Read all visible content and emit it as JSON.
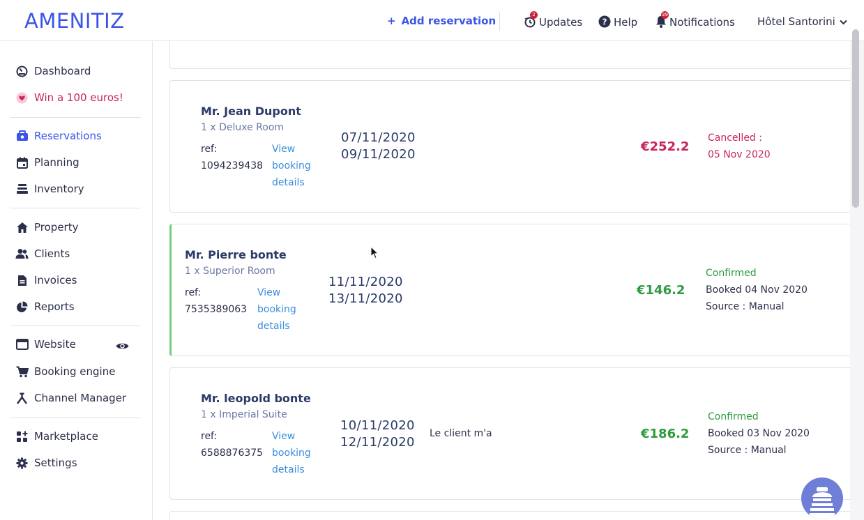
{
  "brand": {
    "logo": "AMENITIZ"
  },
  "header": {
    "add_reservation": "Add reservation",
    "updates": {
      "label": "Updates",
      "badge": "2"
    },
    "help": "Help",
    "notifications": {
      "label": "Notifications",
      "badge": "39"
    },
    "hotel": "Hôtel Santorini"
  },
  "sidebar": {
    "dashboard": "Dashboard",
    "promo": "Win a 100 euros!",
    "reservations": "Reservations",
    "planning": "Planning",
    "inventory": "Inventory",
    "property": "Property",
    "clients": "Clients",
    "invoices": "Invoices",
    "reports": "Reports",
    "website": "Website",
    "booking_engine": "Booking engine",
    "channel_manager": "Channel Manager",
    "marketplace": "Marketplace",
    "settings": "Settings"
  },
  "reservations": [
    {
      "guest": "Mr. Jean Dupont",
      "room": "1 x Deluxe Room",
      "ref_label": "ref:",
      "ref": "1094239438",
      "view_link": "View booking details",
      "arrival": "07/11/2020",
      "departure": "09/11/2020",
      "note": "",
      "price": "€252.2",
      "status": "Cancelled :",
      "status_line2": "05 Nov 2020",
      "status_line3": ""
    },
    {
      "guest": "Mr. Pierre bonte",
      "room": "1 x Superior Room",
      "ref_label": "ref:",
      "ref": "7535389063",
      "view_link": "View booking details",
      "arrival": "11/11/2020",
      "departure": "13/11/2020",
      "note": "",
      "price": "€146.2",
      "status": "Confirmed",
      "status_line2": "Booked 04 Nov 2020",
      "status_line3": "Source : Manual"
    },
    {
      "guest": "Mr. leopold bonte",
      "room": "1 x Imperial Suite",
      "ref_label": "ref:",
      "ref": "6588876375",
      "view_link": "View booking details",
      "arrival": "10/11/2020",
      "departure": "12/11/2020",
      "note": "Le client m'a",
      "price": "€186.2",
      "status": "Confirmed",
      "status_line2": "Booked 03 Nov 2020",
      "status_line3": "Source : Manual"
    }
  ],
  "colors": {
    "accent": "#3b55e6",
    "cancelled": "#c8245e",
    "confirmed": "#2e9b3e",
    "link": "#3a8ddb",
    "selected_border": "#6fcf7d"
  }
}
